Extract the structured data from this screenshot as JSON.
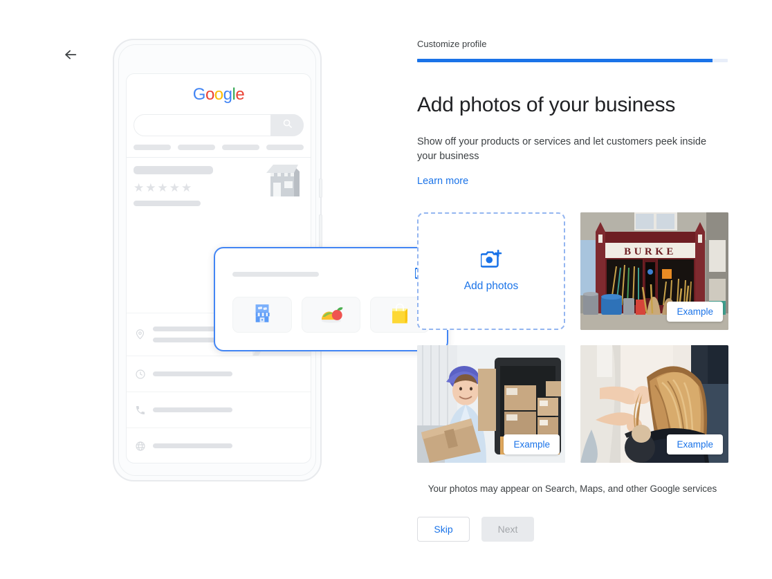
{
  "nav": {
    "back_label": "Back",
    "back_icon": "arrow-left-icon"
  },
  "wizard": {
    "step_label": "Customize profile",
    "progress_percent": 95
  },
  "content": {
    "title": "Add photos of your business",
    "subtitle": "Show off your products or services and let customers peek inside your business",
    "learn_more": "Learn more",
    "footnote": "Your photos may appear on Search, Maps, and other Google services"
  },
  "uploader": {
    "icon": "add-a-photo-icon",
    "label": "Add photos"
  },
  "examples": [
    {
      "badge": "Example",
      "alt": "Hardware store front with BURKE signage and tools displayed outside",
      "sign_text": "BURKE"
    },
    {
      "badge": "Example",
      "alt": "Delivery worker in blue cap holding a cardboard box beside a loaded van"
    },
    {
      "badge": "Example",
      "alt": "Hair stylist combing a client's long hair in a salon"
    }
  ],
  "actions": {
    "skip_label": "Skip",
    "next_label": "Next",
    "next_disabled": true
  },
  "illustration": {
    "google_logo": [
      "G",
      "o",
      "o",
      "g",
      "l",
      "e"
    ],
    "search_icon": "search-icon",
    "stars": "★★★★★",
    "card_camera_icon": "add-a-photo-icon",
    "tiles": [
      "storefront-icon",
      "food-icon",
      "shopping-bag-icon"
    ],
    "rows": [
      {
        "icon": "location-pin-icon"
      },
      {
        "icon": "clock-icon"
      },
      {
        "icon": "phone-icon"
      },
      {
        "icon": "globe-icon"
      }
    ]
  },
  "colors": {
    "accent_blue": "#1a73e8",
    "progress_track": "#e8eef9",
    "dashed_border": "#93b5f0",
    "card_outline": "#4285f4",
    "google_blue": "#4285f4",
    "google_red": "#ea4335",
    "google_yellow": "#fbbc05",
    "google_green": "#34a853",
    "disabled_button_bg": "#e8eaed"
  }
}
